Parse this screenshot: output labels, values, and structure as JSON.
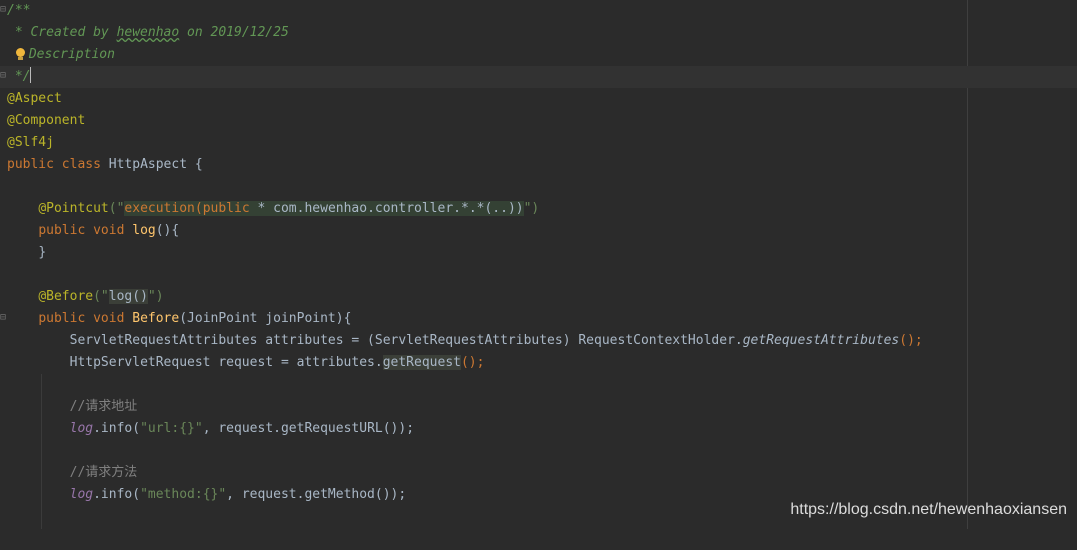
{
  "colors": {
    "background": "#2b2b2b",
    "doc_comment": "#629755",
    "annotation": "#bbb529",
    "keyword": "#cc7832",
    "string": "#6a8759",
    "method_decl": "#ffc66d",
    "static_field": "#9876aa",
    "comment": "#808080",
    "plain": "#a9b7c6"
  },
  "code": {
    "doc_open": "/**",
    "created_prefix": " * Created by ",
    "author": "hewenhao",
    "created_suffix": " on 2019/12/25",
    "description": "Description",
    "doc_close": " */",
    "ann_aspect": "@Aspect",
    "ann_component": "@Component",
    "ann_slf4j": "@Slf4j",
    "kw_public": "public",
    "kw_class": "class",
    "class_name": "HttpAspect {",
    "ann_pointcut": "@Pointcut",
    "pointcut_open": "(\"",
    "pointcut_exec": "execution(",
    "pointcut_public": "public",
    "pointcut_rest": " * com.hewenhao.controller.*.*(..))",
    "pointcut_close": "\")",
    "kw_void": "void",
    "method_log": "log",
    "log_sig": "(){",
    "close_brace": "}",
    "ann_before": "@Before",
    "before_open": "(\"",
    "before_value": "log()",
    "before_close": "\")",
    "method_before": "Before",
    "before_sig": "(JoinPoint joinPoint){",
    "attr_decl": "ServletRequestAttributes attributes = (ServletRequestAttributes) RequestContextHolder.",
    "attr_call": "getRequestAttributes",
    "call_end": "();",
    "req_decl": "HttpServletRequest request = attributes.",
    "req_call": "getRequest",
    "comment_url": "//请求地址",
    "log_field": "log",
    "info_call": ".info(",
    "url_fmt": "\"url:{}\"",
    "url_args": ", request.getRequestURL());",
    "comment_method": "//请求方法",
    "method_fmt": "\"method:{}\"",
    "method_args": ", request.getMethod());"
  },
  "watermark": "https://blog.csdn.net/hewenhaoxiansen"
}
